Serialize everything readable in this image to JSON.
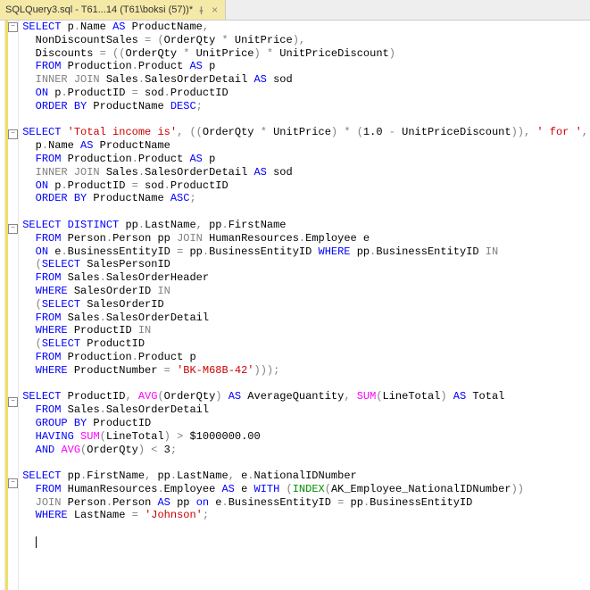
{
  "tab": {
    "title": "SQLQuery3.sql - T61...14 (T61\\boksi (57))*",
    "dirty_marker": "*"
  },
  "code_lines": [
    {
      "fold": "-",
      "t": [
        {
          "c": "kw",
          "s": "SELECT"
        },
        {
          "s": " p"
        },
        {
          "c": "gy",
          "s": "."
        },
        {
          "s": "Name "
        },
        {
          "c": "kw",
          "s": "AS"
        },
        {
          "s": " ProductName"
        },
        {
          "c": "gy",
          "s": ","
        }
      ]
    },
    {
      "t": [
        {
          "s": "  NonDiscountSales "
        },
        {
          "c": "gy",
          "s": "="
        },
        {
          "s": " "
        },
        {
          "c": "gy",
          "s": "("
        },
        {
          "s": "OrderQty "
        },
        {
          "c": "gy",
          "s": "*"
        },
        {
          "s": " UnitPrice"
        },
        {
          "c": "gy",
          "s": "),"
        }
      ]
    },
    {
      "t": [
        {
          "s": "  Discounts "
        },
        {
          "c": "gy",
          "s": "= (("
        },
        {
          "s": "OrderQty "
        },
        {
          "c": "gy",
          "s": "*"
        },
        {
          "s": " UnitPrice"
        },
        {
          "c": "gy",
          "s": ")"
        },
        {
          "s": " "
        },
        {
          "c": "gy",
          "s": "*"
        },
        {
          "s": " UnitPriceDiscount"
        },
        {
          "c": "gy",
          "s": ")"
        }
      ]
    },
    {
      "t": [
        {
          "s": "  "
        },
        {
          "c": "kw",
          "s": "FROM"
        },
        {
          "s": " Production"
        },
        {
          "c": "gy",
          "s": "."
        },
        {
          "s": "Product "
        },
        {
          "c": "kw",
          "s": "AS"
        },
        {
          "s": " p"
        }
      ]
    },
    {
      "t": [
        {
          "s": "  "
        },
        {
          "c": "gy",
          "s": "INNER JOIN"
        },
        {
          "s": " Sales"
        },
        {
          "c": "gy",
          "s": "."
        },
        {
          "s": "SalesOrderDetail "
        },
        {
          "c": "kw",
          "s": "AS"
        },
        {
          "s": " sod"
        }
      ]
    },
    {
      "t": [
        {
          "s": "  "
        },
        {
          "c": "kw",
          "s": "ON"
        },
        {
          "s": " p"
        },
        {
          "c": "gy",
          "s": "."
        },
        {
          "s": "ProductID "
        },
        {
          "c": "gy",
          "s": "="
        },
        {
          "s": " sod"
        },
        {
          "c": "gy",
          "s": "."
        },
        {
          "s": "ProductID"
        }
      ]
    },
    {
      "t": [
        {
          "s": "  "
        },
        {
          "c": "kw",
          "s": "ORDER BY"
        },
        {
          "s": " ProductName "
        },
        {
          "c": "kw",
          "s": "DESC"
        },
        {
          "c": "gy",
          "s": ";"
        }
      ]
    },
    {
      "t": [
        {
          "s": ""
        }
      ]
    },
    {
      "fold": "-",
      "t": [
        {
          "c": "kw",
          "s": "SELECT"
        },
        {
          "s": " "
        },
        {
          "c": "st",
          "s": "'Total income is'"
        },
        {
          "c": "gy",
          "s": ", (("
        },
        {
          "s": "OrderQty "
        },
        {
          "c": "gy",
          "s": "*"
        },
        {
          "s": " UnitPrice"
        },
        {
          "c": "gy",
          "s": ")"
        },
        {
          "s": " "
        },
        {
          "c": "gy",
          "s": "* ("
        },
        {
          "s": "1.0 "
        },
        {
          "c": "gy",
          "s": "-"
        },
        {
          "s": " UnitPriceDiscount"
        },
        {
          "c": "gy",
          "s": ")),"
        },
        {
          "s": " "
        },
        {
          "c": "st",
          "s": "' for '"
        },
        {
          "c": "gy",
          "s": ","
        }
      ]
    },
    {
      "t": [
        {
          "s": "  p"
        },
        {
          "c": "gy",
          "s": "."
        },
        {
          "s": "Name "
        },
        {
          "c": "kw",
          "s": "AS"
        },
        {
          "s": " ProductName"
        }
      ]
    },
    {
      "t": [
        {
          "s": "  "
        },
        {
          "c": "kw",
          "s": "FROM"
        },
        {
          "s": " Production"
        },
        {
          "c": "gy",
          "s": "."
        },
        {
          "s": "Product "
        },
        {
          "c": "kw",
          "s": "AS"
        },
        {
          "s": " p"
        }
      ]
    },
    {
      "t": [
        {
          "s": "  "
        },
        {
          "c": "gy",
          "s": "INNER JOIN"
        },
        {
          "s": " Sales"
        },
        {
          "c": "gy",
          "s": "."
        },
        {
          "s": "SalesOrderDetail "
        },
        {
          "c": "kw",
          "s": "AS"
        },
        {
          "s": " sod"
        }
      ]
    },
    {
      "t": [
        {
          "s": "  "
        },
        {
          "c": "kw",
          "s": "ON"
        },
        {
          "s": " p"
        },
        {
          "c": "gy",
          "s": "."
        },
        {
          "s": "ProductID "
        },
        {
          "c": "gy",
          "s": "="
        },
        {
          "s": " sod"
        },
        {
          "c": "gy",
          "s": "."
        },
        {
          "s": "ProductID"
        }
      ]
    },
    {
      "t": [
        {
          "s": "  "
        },
        {
          "c": "kw",
          "s": "ORDER BY"
        },
        {
          "s": " ProductName "
        },
        {
          "c": "kw",
          "s": "ASC"
        },
        {
          "c": "gy",
          "s": ";"
        }
      ]
    },
    {
      "t": [
        {
          "s": ""
        }
      ]
    },
    {
      "fold": "-",
      "t": [
        {
          "c": "kw",
          "s": "SELECT"
        },
        {
          "s": " "
        },
        {
          "c": "kw",
          "s": "DISTINCT"
        },
        {
          "s": " pp"
        },
        {
          "c": "gy",
          "s": "."
        },
        {
          "s": "LastName"
        },
        {
          "c": "gy",
          "s": ","
        },
        {
          "s": " pp"
        },
        {
          "c": "gy",
          "s": "."
        },
        {
          "s": "FirstName"
        }
      ]
    },
    {
      "t": [
        {
          "s": "  "
        },
        {
          "c": "kw",
          "s": "FROM"
        },
        {
          "s": " Person"
        },
        {
          "c": "gy",
          "s": "."
        },
        {
          "s": "Person pp "
        },
        {
          "c": "gy",
          "s": "JOIN"
        },
        {
          "s": " HumanResources"
        },
        {
          "c": "gy",
          "s": "."
        },
        {
          "s": "Employee e"
        }
      ]
    },
    {
      "t": [
        {
          "s": "  "
        },
        {
          "c": "kw",
          "s": "ON"
        },
        {
          "s": " e"
        },
        {
          "c": "gy",
          "s": "."
        },
        {
          "s": "BusinessEntityID "
        },
        {
          "c": "gy",
          "s": "="
        },
        {
          "s": " pp"
        },
        {
          "c": "gy",
          "s": "."
        },
        {
          "s": "BusinessEntityID "
        },
        {
          "c": "kw",
          "s": "WHERE"
        },
        {
          "s": " pp"
        },
        {
          "c": "gy",
          "s": "."
        },
        {
          "s": "BusinessEntityID "
        },
        {
          "c": "gy",
          "s": "IN"
        }
      ]
    },
    {
      "t": [
        {
          "s": "  "
        },
        {
          "c": "gy",
          "s": "("
        },
        {
          "c": "kw",
          "s": "SELECT"
        },
        {
          "s": " SalesPersonID"
        }
      ]
    },
    {
      "t": [
        {
          "s": "  "
        },
        {
          "c": "kw",
          "s": "FROM"
        },
        {
          "s": " Sales"
        },
        {
          "c": "gy",
          "s": "."
        },
        {
          "s": "SalesOrderHeader"
        }
      ]
    },
    {
      "t": [
        {
          "s": "  "
        },
        {
          "c": "kw",
          "s": "WHERE"
        },
        {
          "s": " SalesOrderID "
        },
        {
          "c": "gy",
          "s": "IN"
        }
      ]
    },
    {
      "t": [
        {
          "s": "  "
        },
        {
          "c": "gy",
          "s": "("
        },
        {
          "c": "kw",
          "s": "SELECT"
        },
        {
          "s": " SalesOrderID"
        }
      ]
    },
    {
      "t": [
        {
          "s": "  "
        },
        {
          "c": "kw",
          "s": "FROM"
        },
        {
          "s": " Sales"
        },
        {
          "c": "gy",
          "s": "."
        },
        {
          "s": "SalesOrderDetail"
        }
      ]
    },
    {
      "t": [
        {
          "s": "  "
        },
        {
          "c": "kw",
          "s": "WHERE"
        },
        {
          "s": " ProductID "
        },
        {
          "c": "gy",
          "s": "IN"
        }
      ]
    },
    {
      "t": [
        {
          "s": "  "
        },
        {
          "c": "gy",
          "s": "("
        },
        {
          "c": "kw",
          "s": "SELECT"
        },
        {
          "s": " ProductID"
        }
      ]
    },
    {
      "t": [
        {
          "s": "  "
        },
        {
          "c": "kw",
          "s": "FROM"
        },
        {
          "s": " Production"
        },
        {
          "c": "gy",
          "s": "."
        },
        {
          "s": "Product p"
        }
      ]
    },
    {
      "t": [
        {
          "s": "  "
        },
        {
          "c": "kw",
          "s": "WHERE"
        },
        {
          "s": " ProductNumber "
        },
        {
          "c": "gy",
          "s": "="
        },
        {
          "s": " "
        },
        {
          "c": "st",
          "s": "'BK-M68B-42'"
        },
        {
          "c": "gy",
          "s": ")));"
        }
      ]
    },
    {
      "t": [
        {
          "s": ""
        }
      ]
    },
    {
      "fold": "-",
      "t": [
        {
          "c": "kw",
          "s": "SELECT"
        },
        {
          "s": " ProductID"
        },
        {
          "c": "gy",
          "s": ","
        },
        {
          "s": " "
        },
        {
          "c": "fn",
          "s": "AVG"
        },
        {
          "c": "gy",
          "s": "("
        },
        {
          "s": "OrderQty"
        },
        {
          "c": "gy",
          "s": ")"
        },
        {
          "s": " "
        },
        {
          "c": "kw",
          "s": "AS"
        },
        {
          "s": " AverageQuantity"
        },
        {
          "c": "gy",
          "s": ","
        },
        {
          "s": " "
        },
        {
          "c": "fn",
          "s": "SUM"
        },
        {
          "c": "gy",
          "s": "("
        },
        {
          "s": "LineTotal"
        },
        {
          "c": "gy",
          "s": ")"
        },
        {
          "s": " "
        },
        {
          "c": "kw",
          "s": "AS"
        },
        {
          "s": " Total"
        }
      ]
    },
    {
      "t": [
        {
          "s": "  "
        },
        {
          "c": "kw",
          "s": "FROM"
        },
        {
          "s": " Sales"
        },
        {
          "c": "gy",
          "s": "."
        },
        {
          "s": "SalesOrderDetail"
        }
      ]
    },
    {
      "t": [
        {
          "s": "  "
        },
        {
          "c": "kw",
          "s": "GROUP BY"
        },
        {
          "s": " ProductID"
        }
      ]
    },
    {
      "t": [
        {
          "s": "  "
        },
        {
          "c": "kw",
          "s": "HAVING"
        },
        {
          "s": " "
        },
        {
          "c": "fn",
          "s": "SUM"
        },
        {
          "c": "gy",
          "s": "("
        },
        {
          "s": "LineTotal"
        },
        {
          "c": "gy",
          "s": ")"
        },
        {
          "s": " "
        },
        {
          "c": "gy",
          "s": ">"
        },
        {
          "s": " $1000000.00"
        }
      ]
    },
    {
      "t": [
        {
          "s": "  "
        },
        {
          "c": "kw",
          "s": "AND"
        },
        {
          "s": " "
        },
        {
          "c": "fn",
          "s": "AVG"
        },
        {
          "c": "gy",
          "s": "("
        },
        {
          "s": "OrderQty"
        },
        {
          "c": "gy",
          "s": ")"
        },
        {
          "s": " "
        },
        {
          "c": "gy",
          "s": "<"
        },
        {
          "s": " 3"
        },
        {
          "c": "gy",
          "s": ";"
        }
      ]
    },
    {
      "t": [
        {
          "s": ""
        }
      ]
    },
    {
      "fold": "-",
      "t": [
        {
          "c": "kw",
          "s": "SELECT"
        },
        {
          "s": " pp"
        },
        {
          "c": "gy",
          "s": "."
        },
        {
          "s": "FirstName"
        },
        {
          "c": "gy",
          "s": ","
        },
        {
          "s": " pp"
        },
        {
          "c": "gy",
          "s": "."
        },
        {
          "s": "LastName"
        },
        {
          "c": "gy",
          "s": ","
        },
        {
          "s": " e"
        },
        {
          "c": "gy",
          "s": "."
        },
        {
          "s": "NationalIDNumber"
        }
      ]
    },
    {
      "t": [
        {
          "s": "  "
        },
        {
          "c": "kw",
          "s": "FROM"
        },
        {
          "s": " HumanResources"
        },
        {
          "c": "gy",
          "s": "."
        },
        {
          "s": "Employee "
        },
        {
          "c": "kw",
          "s": "AS"
        },
        {
          "s": " e "
        },
        {
          "c": "kw",
          "s": "WITH"
        },
        {
          "s": " "
        },
        {
          "c": "gy",
          "s": "("
        },
        {
          "c": "gr",
          "s": "INDEX"
        },
        {
          "c": "gy",
          "s": "("
        },
        {
          "s": "AK_Employee_NationalIDNumber"
        },
        {
          "c": "gy",
          "s": "))"
        }
      ]
    },
    {
      "t": [
        {
          "s": "  "
        },
        {
          "c": "gy",
          "s": "JOIN"
        },
        {
          "s": " Person"
        },
        {
          "c": "gy",
          "s": "."
        },
        {
          "s": "Person "
        },
        {
          "c": "kw",
          "s": "AS"
        },
        {
          "s": " pp "
        },
        {
          "c": "kw",
          "s": "on"
        },
        {
          "s": " e"
        },
        {
          "c": "gy",
          "s": "."
        },
        {
          "s": "BusinessEntityID "
        },
        {
          "c": "gy",
          "s": "="
        },
        {
          "s": " pp"
        },
        {
          "c": "gy",
          "s": "."
        },
        {
          "s": "BusinessEntityID"
        }
      ]
    },
    {
      "t": [
        {
          "s": "  "
        },
        {
          "c": "kw",
          "s": "WHERE"
        },
        {
          "s": " LastName "
        },
        {
          "c": "gy",
          "s": "="
        },
        {
          "s": " "
        },
        {
          "c": "st",
          "s": "'Johnson'"
        },
        {
          "c": "gy",
          "s": ";"
        }
      ]
    },
    {
      "t": [
        {
          "s": ""
        }
      ]
    },
    {
      "cursor": true,
      "t": [
        {
          "s": "  "
        }
      ]
    }
  ]
}
